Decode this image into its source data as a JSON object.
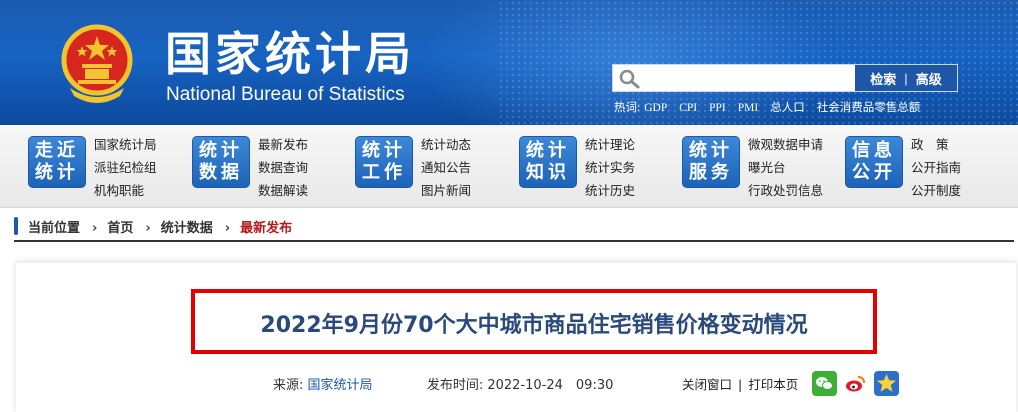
{
  "header": {
    "title_cn": "国家统计局",
    "title_en": "National Bureau of Statistics"
  },
  "search": {
    "placeholder": "",
    "search_label": "检索",
    "separator": "|",
    "advanced_label": "高级"
  },
  "hot": {
    "label": "热词:",
    "items": [
      "GDP",
      "CPI",
      "PPI",
      "PMI",
      "总人口",
      "社会消费品零售总额"
    ]
  },
  "nav": [
    {
      "badge": [
        "走近",
        "统计"
      ],
      "links": [
        "国家统计局",
        "派驻纪检组",
        "机构职能"
      ]
    },
    {
      "badge": [
        "统计",
        "数据"
      ],
      "links": [
        "最新发布",
        "数据查询",
        "数据解读"
      ]
    },
    {
      "badge": [
        "统计",
        "工作"
      ],
      "links": [
        "统计动态",
        "通知公告",
        "图片新闻"
      ]
    },
    {
      "badge": [
        "统计",
        "知识"
      ],
      "links": [
        "统计理论",
        "统计实务",
        "统计历史"
      ]
    },
    {
      "badge": [
        "统计",
        "服务"
      ],
      "links": [
        "微观数据申请",
        "曝光台",
        "行政处罚信息"
      ]
    },
    {
      "badge": [
        "信息",
        "公开"
      ],
      "links": [
        "政　策",
        "公开指南",
        "公开制度"
      ]
    }
  ],
  "breadcrumb": {
    "location_label": "当前位置",
    "items": [
      "首页",
      "统计数据"
    ],
    "current": "最新发布",
    "arrow": "›"
  },
  "article": {
    "title": "2022年9月份70个大中城市商品住宅销售价格变动情况",
    "source_label": "来源:",
    "source": "国家统计局",
    "published_label": "发布时间:",
    "published": "2022-10-24　09:30",
    "close_label": "关闭窗口",
    "print_label": "打印本页"
  },
  "colors": {
    "brand_blue": "#1e57a8",
    "highlight_red": "#e40000",
    "current_crumb": "#b31b1b"
  },
  "icons": {
    "share": [
      "wechat-icon",
      "weibo-icon",
      "favorite-star-icon"
    ]
  }
}
